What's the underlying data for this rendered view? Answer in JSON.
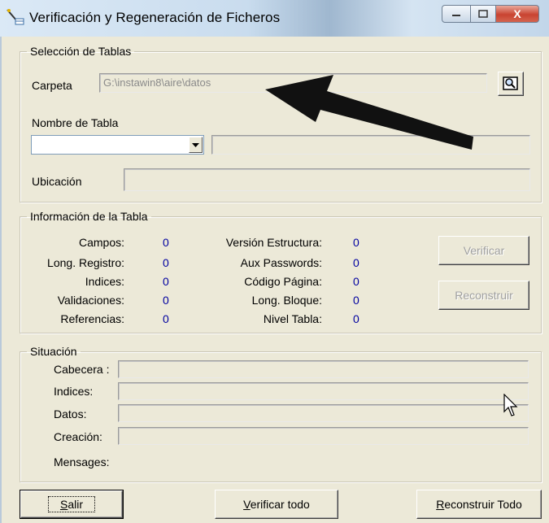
{
  "window": {
    "title": "Verificación y Regeneración de Ficheros",
    "close_glyph": "X"
  },
  "seleccion": {
    "legend": "Selección de Tablas",
    "carpeta_label": "Carpeta",
    "carpeta_value": "G:\\instawin8\\aire\\datos",
    "nombre_tabla_label": "Nombre de Tabla",
    "nombre_tabla_value": "",
    "nombre_tabla_desc": "",
    "ubicacion_label": "Ubicación",
    "ubicacion_value": ""
  },
  "informacion": {
    "legend": "Información de la Tabla",
    "left_fields": [
      {
        "label": "Campos:",
        "value": "0"
      },
      {
        "label": "Long. Registro:",
        "value": "0"
      },
      {
        "label": "Indices:",
        "value": "0"
      },
      {
        "label": "Validaciones:",
        "value": "0"
      },
      {
        "label": "Referencias:",
        "value": "0"
      }
    ],
    "right_fields": [
      {
        "label": "Versión Estructura:",
        "value": "0"
      },
      {
        "label": "Aux Passwords:",
        "value": "0"
      },
      {
        "label": "Código Página:",
        "value": "0"
      },
      {
        "label": "Long. Bloque:",
        "value": "0"
      },
      {
        "label": "Nivel Tabla:",
        "value": "0"
      }
    ],
    "verificar_label": "Verificar",
    "reconstruir_label": "Reconstruir"
  },
  "situacion": {
    "legend": "Situación",
    "cabecera_label": "Cabecera :",
    "indices_label": "Indices:",
    "datos_label": "Datos:",
    "creacion_label": "Creación:",
    "mensages_label": "Mensages:"
  },
  "footer": {
    "salir_first": "S",
    "salir_rest": "alir",
    "verificar_todo_first": "V",
    "verificar_todo_rest": "erificar todo",
    "reconstruir_todo_first": "R",
    "reconstruir_todo_rest": "econstruir Todo"
  },
  "icons": {
    "app": "table-wand-icon",
    "browse": "folder-search-icon",
    "dropdown": "chevron-down-icon",
    "annotation": "arrow-annotation-icon",
    "cursor": "mouse-pointer-icon"
  }
}
